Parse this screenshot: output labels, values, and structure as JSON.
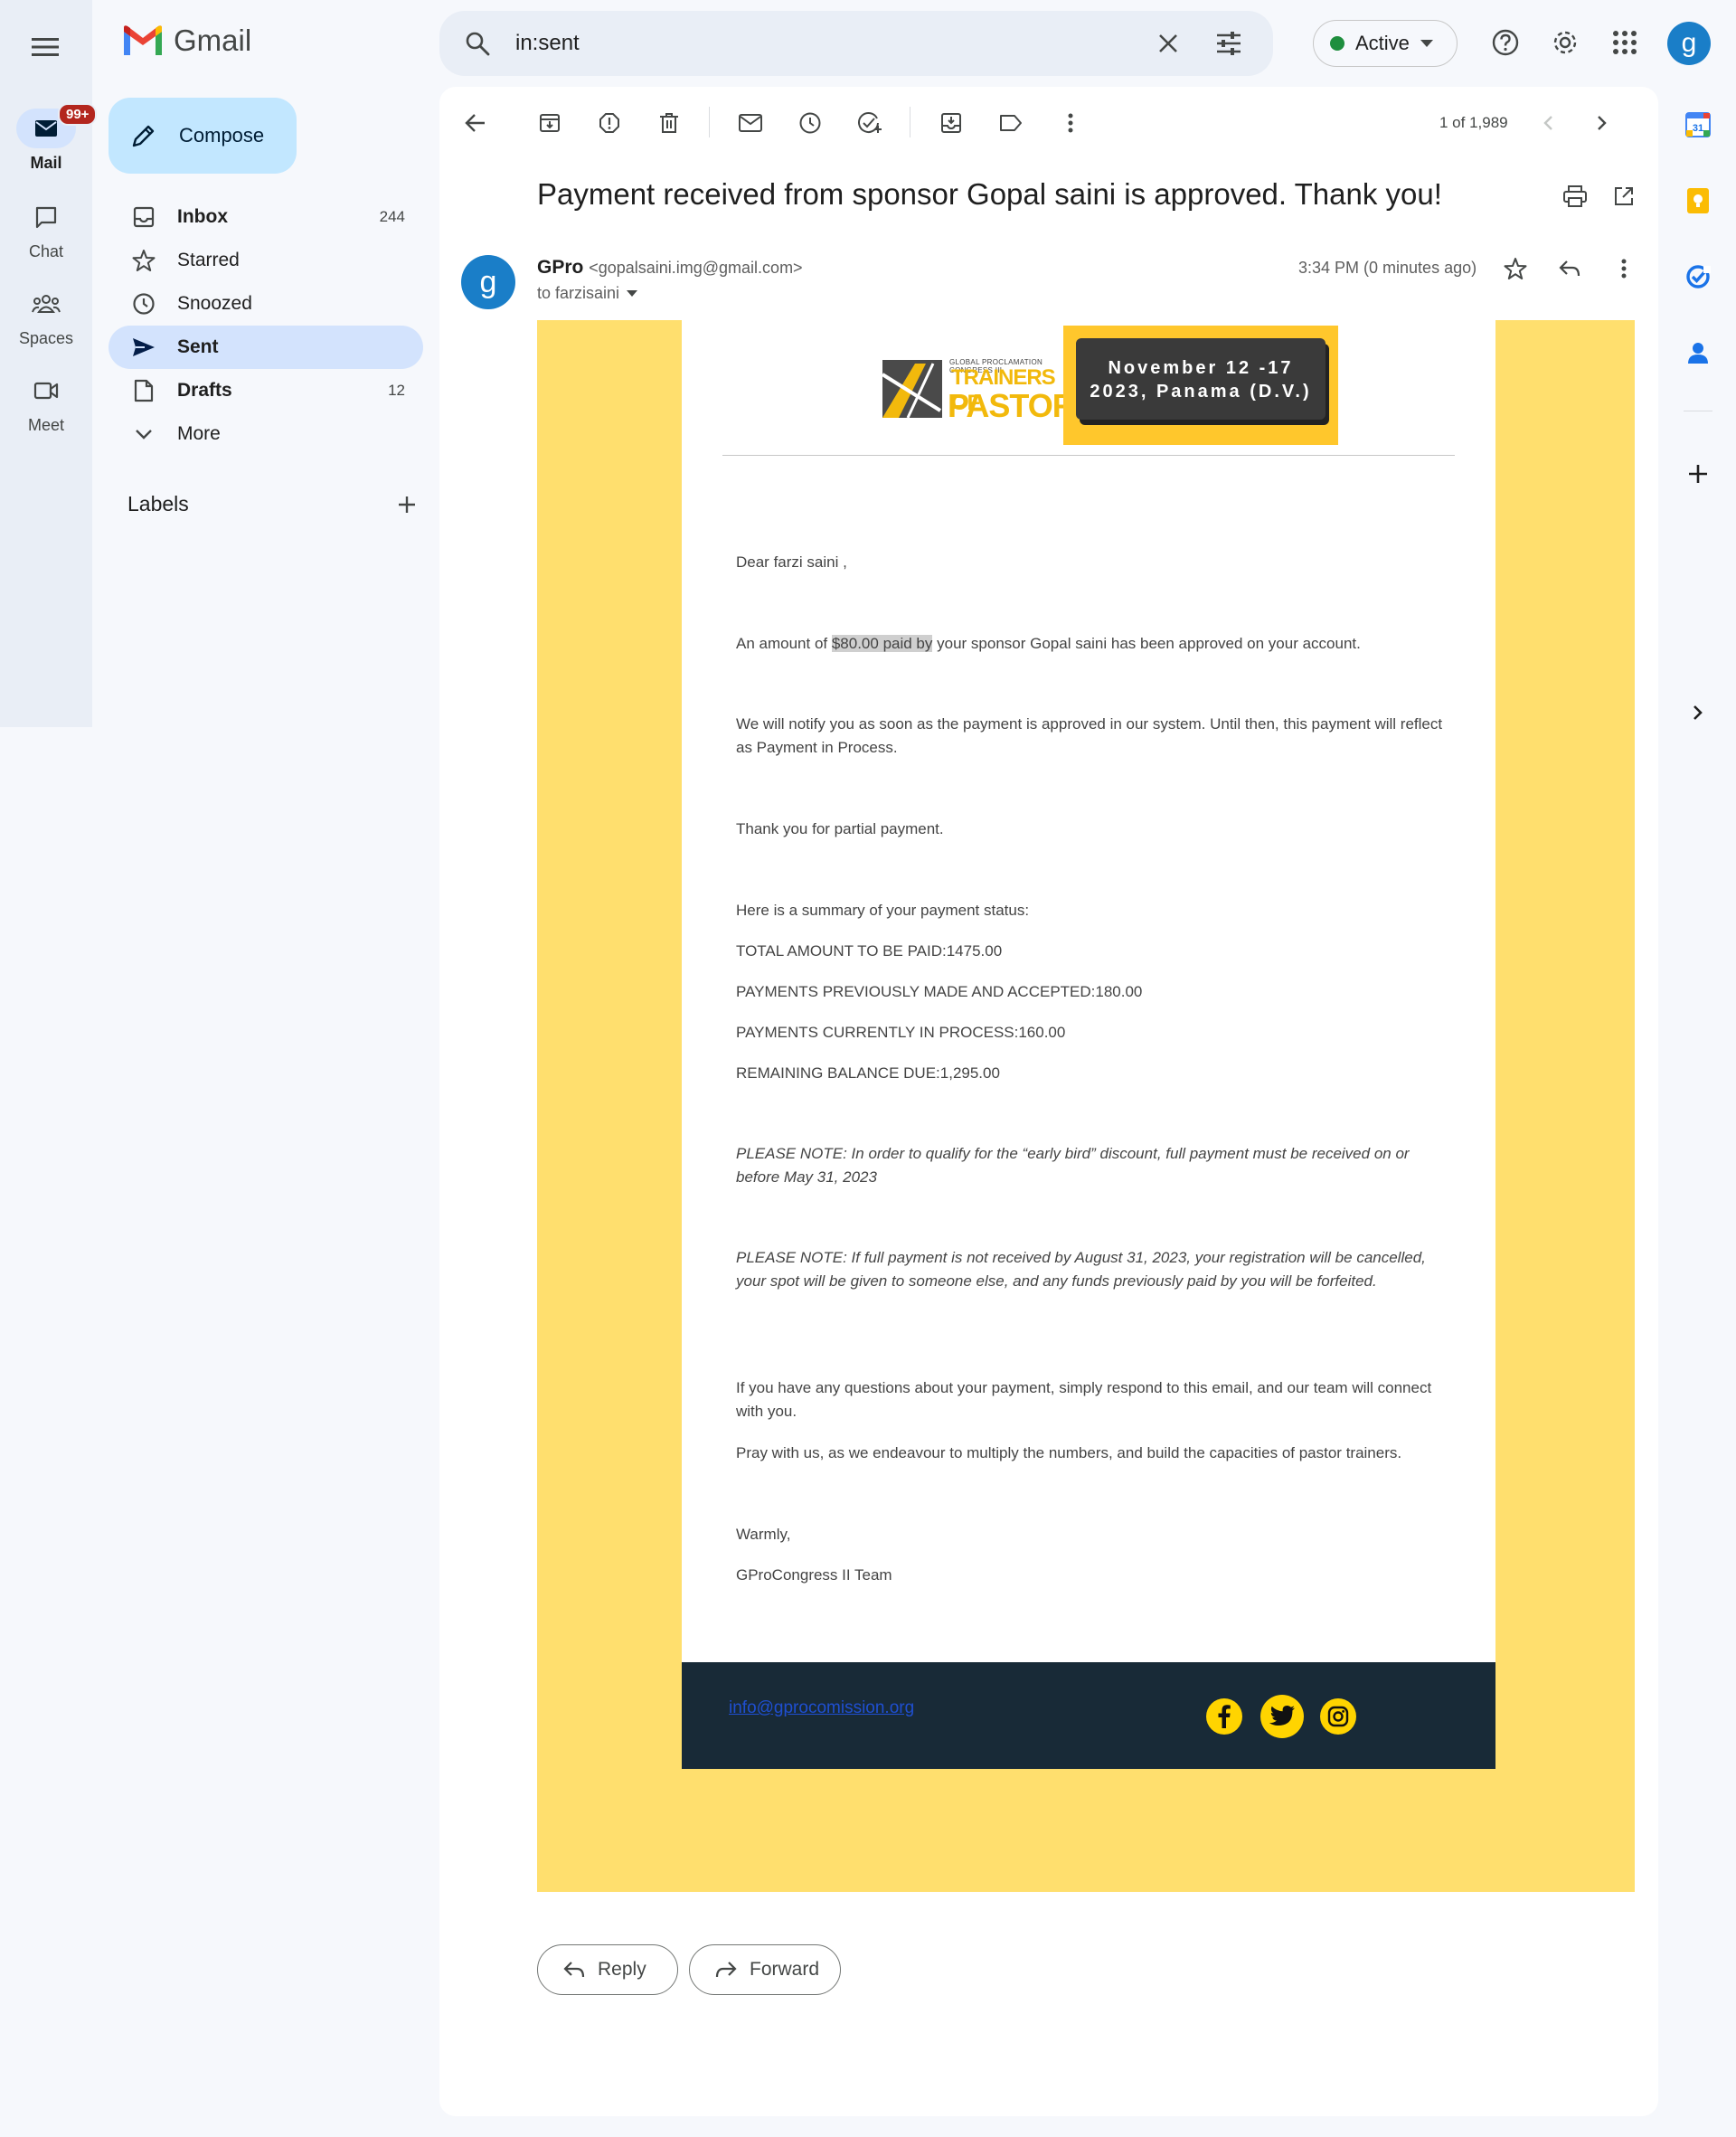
{
  "app": {
    "name": "Gmail",
    "user_initial": "g"
  },
  "rail": {
    "mail_label": "Mail",
    "mail_badge": "99+",
    "chat_label": "Chat",
    "spaces_label": "Spaces",
    "meet_label": "Meet"
  },
  "search": {
    "query": "in:sent"
  },
  "status": {
    "label": "Active",
    "color": "#1e8e3e"
  },
  "compose": {
    "label": "Compose"
  },
  "nav": {
    "items": [
      {
        "label": "Inbox",
        "count": "244",
        "icon": "inbox-icon"
      },
      {
        "label": "Starred",
        "count": "",
        "icon": "star-icon"
      },
      {
        "label": "Snoozed",
        "count": "",
        "icon": "clock-icon"
      },
      {
        "label": "Sent",
        "count": "",
        "icon": "send-icon"
      },
      {
        "label": "Drafts",
        "count": "12",
        "icon": "draft-icon"
      },
      {
        "label": "More",
        "count": "",
        "icon": "chevron-down-icon"
      }
    ],
    "labels_heading": "Labels"
  },
  "toolbar": {
    "pager": "1 of 1,989"
  },
  "email": {
    "subject": "Payment received from sponsor Gopal saini is approved. Thank you!",
    "sender_initial": "g",
    "sender_name": "GPro",
    "sender_email": "<gopalsaini.img@gmail.com>",
    "recipient": "to farzisaini",
    "time": "3:34 PM (0 minutes ago)",
    "banner": {
      "small_text": "GLOBAL PROCLAMATION CONGRESS III",
      "title_line1": "TRAINERS OF",
      "title_line2": "PASTORS",
      "date_line1": "November 12 -17",
      "date_line2": "2023, Panama (D.V.)"
    },
    "greeting": "Dear farzi saini ,",
    "amount_prefix": "An amount of ",
    "amount_highlight": "$80.00 paid by",
    "amount_suffix": " your sponsor Gopal saini has been approved on your account.",
    "notify": "We will notify you as soon as the payment is approved in our system. Until then, this payment will reflect as Payment in Process.",
    "thanks": "Thank you for partial payment.",
    "summary_heading": "Here is a summary of your payment status:",
    "total": "TOTAL AMOUNT TO BE PAID:1475.00",
    "previous": "PAYMENTS PREVIOUSLY MADE AND ACCEPTED:180.00",
    "current": "PAYMENTS CURRENTLY IN PROCESS:160.00",
    "remaining": "REMAINING BALANCE DUE:1,295.00",
    "note1": "PLEASE NOTE: In order to qualify for the “early bird” discount, full payment must be received on or before May 31, 2023",
    "note2": "PLEASE NOTE: If full payment is not received by August 31, 2023, your registration will be cancelled, your spot will be given to someone else, and any funds previously paid by you will be forfeited.",
    "questions": "If you have any questions about your payment, simply respond to this email, and our team will connect with you.",
    "pray": "Pray with us, as we endeavour to multiply the numbers, and build the capacities of pastor trainers.",
    "closing": "Warmly,",
    "signature": "GProCongress II Team",
    "footer_link": "info@gprocomission.org",
    "accent_color": "#ffdf6e",
    "footer_color": "#182a37"
  },
  "actions": {
    "reply": "Reply",
    "forward": "Forward"
  }
}
